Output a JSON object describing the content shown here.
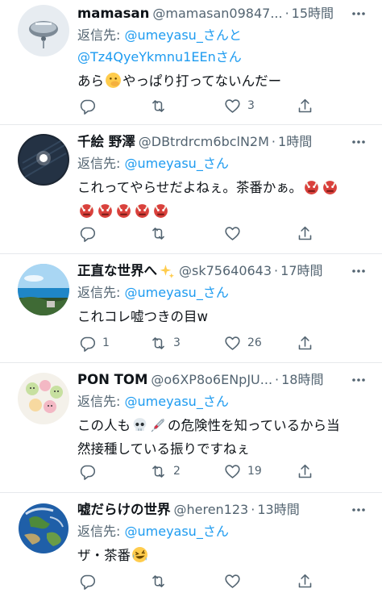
{
  "tweets": [
    {
      "display_name": "mamasan",
      "handle": "@mamasan09847...",
      "time": "15時間",
      "reply_label": "返信先:",
      "reply_mentions": [
        "@umeyasu_さんと",
        "@Tz4QyeYkmnu1EEnさん"
      ],
      "text_parts": [
        "あら",
        "🤭",
        "やっぱり打ってないんだー"
      ],
      "counts": {
        "reply": "",
        "retweet": "",
        "like": "3"
      }
    },
    {
      "display_name": "千絵 野澤",
      "handle": "@DBtrdrcm6bclN2M",
      "time": "1時間",
      "reply_label": "返信先:",
      "reply_mentions": [
        "@umeyasu_さん"
      ],
      "text_line1": "これってやらせだよねぇ。茶番かぁ。",
      "emoji": "👹",
      "counts": {
        "reply": "",
        "retweet": "",
        "like": ""
      }
    },
    {
      "display_name": "正直な世界へ",
      "name_emoji": "✨",
      "handle": "@sk75640643",
      "time": "17時間",
      "reply_label": "返信先:",
      "reply_mentions": [
        "@umeyasu_さん"
      ],
      "text": "これコレ嘘つきの目w",
      "counts": {
        "reply": "1",
        "retweet": "3",
        "like": "26"
      }
    },
    {
      "display_name": "PON TOM",
      "handle": "@o6XP8o6ENpJU...",
      "time": "18時間",
      "reply_label": "返信先:",
      "reply_mentions": [
        "@umeyasu_さん"
      ],
      "text_pre": "この人も",
      "text_emoji_1": "💀",
      "text_emoji_2": "💉",
      "text_post": "の危険性を知っているから当",
      "text_line2": "然接種している振りですねぇ",
      "counts": {
        "reply": "",
        "retweet": "2",
        "like": "19"
      }
    },
    {
      "display_name": "嘘だらけの世界",
      "handle": "@heren123",
      "time": "13時間",
      "reply_label": "返信先:",
      "reply_mentions": [
        "@umeyasu_さん"
      ],
      "text_parts": [
        "ザ・茶番",
        "🤣"
      ],
      "counts": {
        "reply": "",
        "retweet": "",
        "like": ""
      }
    }
  ],
  "separator": "·",
  "icons": {
    "reply": "reply-icon",
    "retweet": "retweet-icon",
    "like": "heart-icon",
    "share": "share-icon",
    "more": "more-icon"
  },
  "colors": {
    "link": "#1d9bf0",
    "secondary_text": "#536471",
    "primary_text": "#0f1419",
    "divider": "#e6e9ec"
  }
}
